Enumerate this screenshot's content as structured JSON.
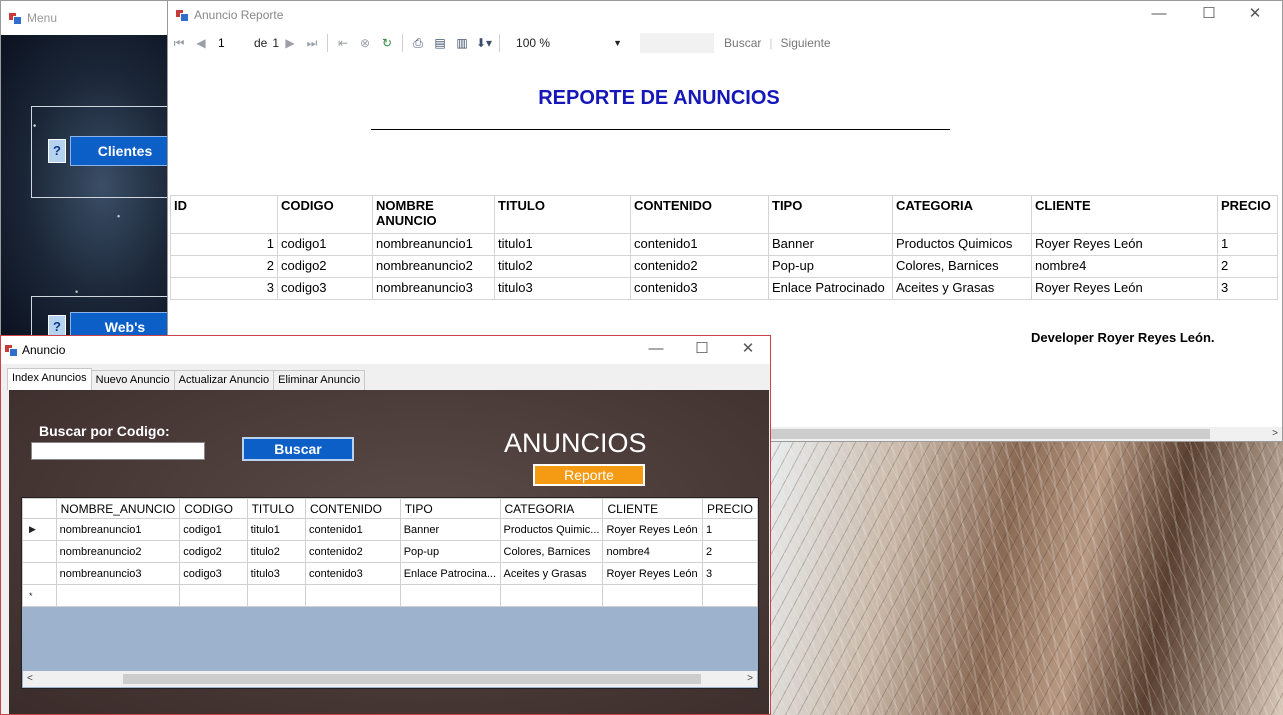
{
  "menu_window": {
    "title": "Menu",
    "buttons": [
      {
        "label": "Clientes",
        "help": "?"
      },
      {
        "label": "Web's",
        "help": "?"
      }
    ]
  },
  "report_window": {
    "title": "Anuncio Reporte",
    "controls": {
      "minimize": "—",
      "maximize": "☐",
      "close": "✕"
    },
    "toolbar": {
      "page_current": "1",
      "page_of": "de",
      "page_total": "1",
      "zoom": "100 %",
      "find_label": "Buscar",
      "next_label": "Siguiente"
    },
    "heading": "REPORTE DE ANUNCIOS",
    "columns": [
      "ID",
      "CODIGO",
      "NOMBRE ANUNCIO",
      "TITULO",
      "CONTENIDO",
      "TIPO",
      "CATEGORIA",
      "CLIENTE",
      "PRECIO"
    ],
    "rows": [
      [
        "1",
        "codigo1",
        "nombreanuncio1",
        "titulo1",
        "contenido1",
        "Banner",
        "Productos Quimicos",
        "Royer Reyes León",
        "1"
      ],
      [
        "2",
        "codigo2",
        "nombreanuncio2",
        "titulo2",
        "contenido2",
        "Pop-up",
        "Colores, Barnices",
        "nombre4",
        "2"
      ],
      [
        "3",
        "codigo3",
        "nombreanuncio3",
        "titulo3",
        "contenido3",
        "Enlace Patrocinado",
        "Aceites y Grasas",
        "Royer Reyes León",
        "3"
      ]
    ],
    "footer": "Developer Royer Reyes León."
  },
  "anuncio_window": {
    "title": "Anuncio",
    "controls": {
      "minimize": "—",
      "maximize": "☐",
      "close": "✕"
    },
    "tabs": [
      "Index Anuncios",
      "Nuevo Anuncio",
      "Actualizar Anuncio",
      "Eliminar Anuncio"
    ],
    "search_label": "Buscar por Codigo:",
    "search_value": "",
    "search_button": "Buscar",
    "heading": "ANUNCIOS",
    "report_button": "Reporte",
    "grid": {
      "columns": [
        "NOMBRE_ANUNCIO",
        "CODIGO",
        "TITULO",
        "CONTENIDO",
        "TIPO",
        "CATEGORIA",
        "CLIENTE",
        "PRECIO"
      ],
      "rows": [
        [
          "nombreanuncio1",
          "codigo1",
          "titulo1",
          "contenido1",
          "Banner",
          "Productos Quimic...",
          "Royer Reyes León",
          "1"
        ],
        [
          "nombreanuncio2",
          "codigo2",
          "titulo2",
          "contenido2",
          "Pop-up",
          "Colores, Barnices",
          "nombre4",
          "2"
        ],
        [
          "nombreanuncio3",
          "codigo3",
          "titulo3",
          "contenido3",
          "Enlace Patrocina...",
          "Aceites y Grasas",
          "Royer Reyes León",
          "3"
        ]
      ],
      "current_row_marker": "▶",
      "new_row_marker": "*"
    }
  }
}
